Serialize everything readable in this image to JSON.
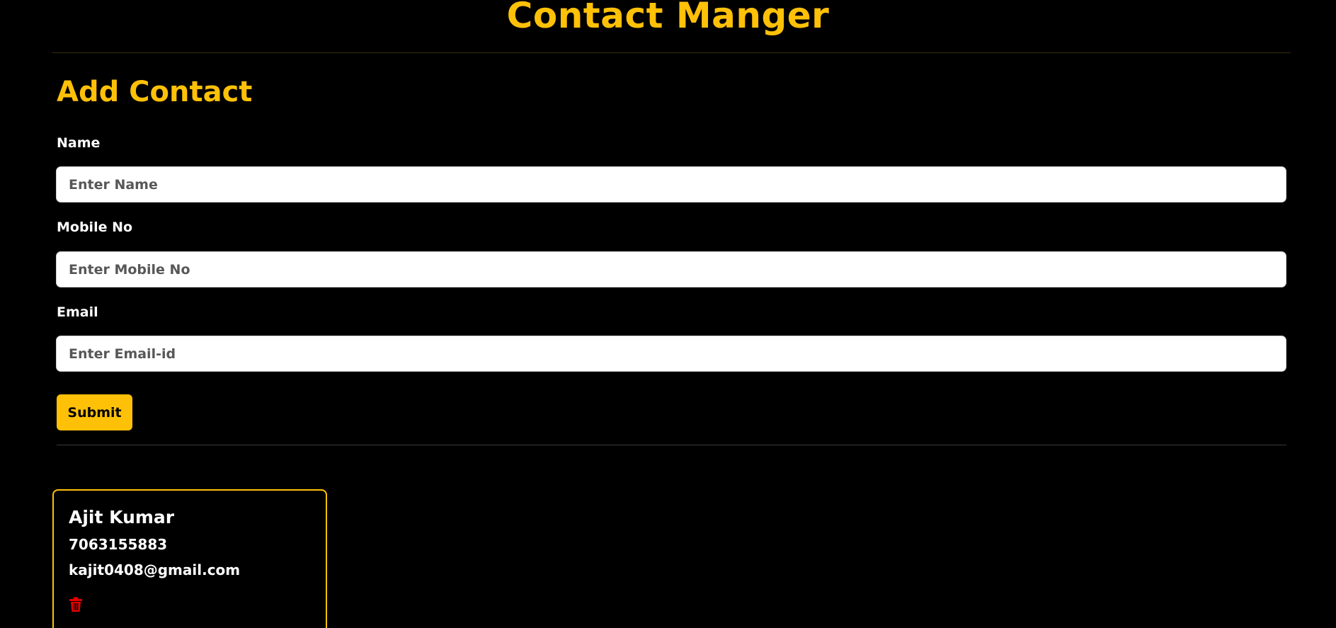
{
  "header": {
    "title": "Contact Manger"
  },
  "form": {
    "heading": "Add Contact",
    "fields": [
      {
        "label": "Name",
        "placeholder": "Enter Name",
        "value": ""
      },
      {
        "label": "Mobile No",
        "placeholder": "Enter Mobile No",
        "value": ""
      },
      {
        "label": "Email",
        "placeholder": "Enter Email-id",
        "value": ""
      }
    ],
    "submit_label": "Submit"
  },
  "contacts": [
    {
      "name": "Ajit Kumar",
      "mobile": "7063155883",
      "email": "kajit0408@gmail.com",
      "delete_icon": "trash-icon"
    }
  ],
  "colors": {
    "background": "#000000",
    "accent": "#ffc107",
    "text": "#ffffff",
    "delete": "#e60000"
  }
}
